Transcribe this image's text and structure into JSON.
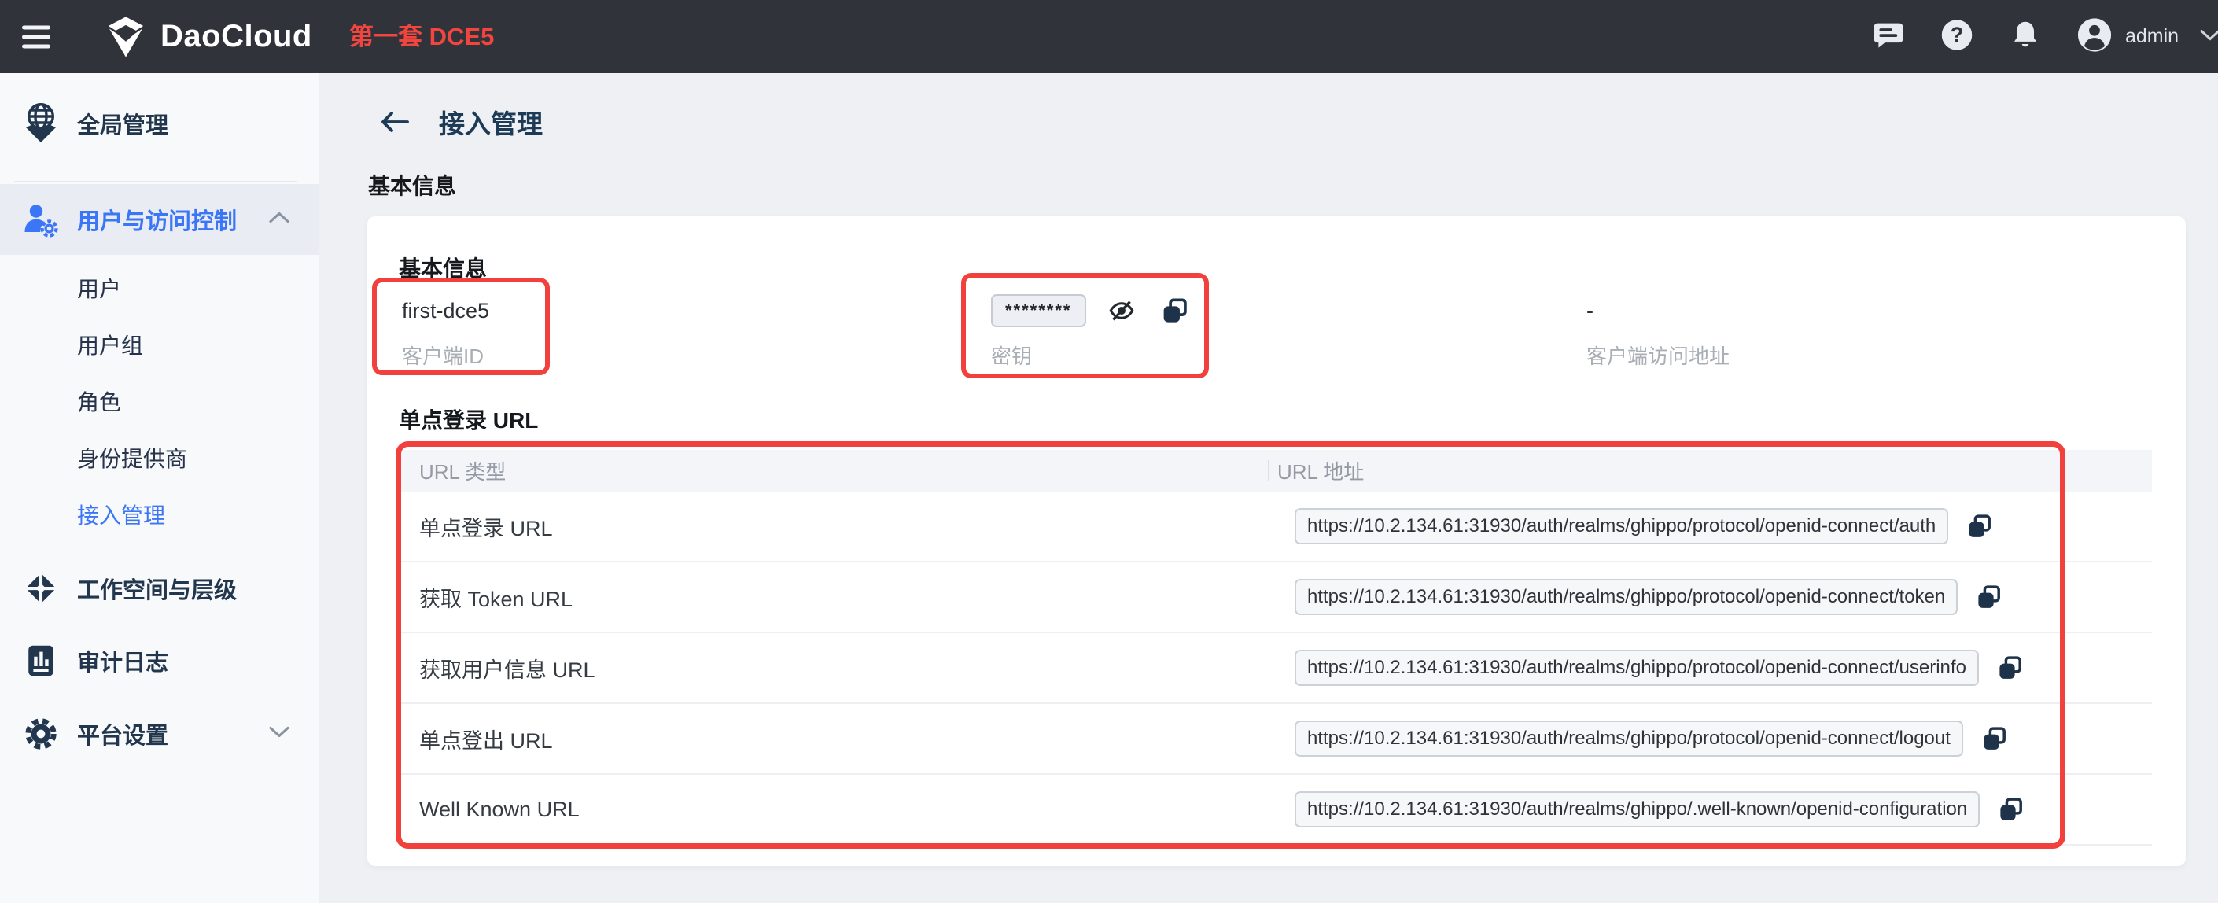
{
  "topbar": {
    "product_name": "DaoCloud",
    "env_title": "第一套 DCE5",
    "username": "admin"
  },
  "sidebar": {
    "global_item": "全局管理",
    "access_group": "用户与访问控制",
    "sub_items": [
      {
        "label": "用户"
      },
      {
        "label": "用户组"
      },
      {
        "label": "角色"
      },
      {
        "label": "身份提供商"
      },
      {
        "label": "接入管理"
      }
    ],
    "workspace_item": "工作空间与层级",
    "audit_item": "审计日志",
    "settings_item": "平台设置"
  },
  "page": {
    "title": "接入管理",
    "section_label": "基本信息"
  },
  "card": {
    "basic_heading": "基本信息",
    "client_id": {
      "value": "first-dce5",
      "label": "客户端ID"
    },
    "secret": {
      "masked_value": "********",
      "label": "密钥"
    },
    "client_access": {
      "value": "-",
      "label": "客户端访问地址"
    },
    "sso_heading": "单点登录 URL",
    "table": {
      "col_type": "URL 类型",
      "col_url": "URL 地址",
      "rows": [
        {
          "type": "单点登录 URL",
          "url": "https://10.2.134.61:31930/auth/realms/ghippo/protocol/openid-connect/auth"
        },
        {
          "type": "获取 Token URL",
          "url": "https://10.2.134.61:31930/auth/realms/ghippo/protocol/openid-connect/token"
        },
        {
          "type": "获取用户信息 URL",
          "url": "https://10.2.134.61:31930/auth/realms/ghippo/protocol/openid-connect/userinfo"
        },
        {
          "type": "单点登出 URL",
          "url": "https://10.2.134.61:31930/auth/realms/ghippo/protocol/openid-connect/logout"
        },
        {
          "type": "Well Known URL",
          "url": "https://10.2.134.61:31930/auth/realms/ghippo/.well-known/openid-configuration"
        }
      ]
    }
  },
  "colors": {
    "accent_red": "#f2413d",
    "accent_blue": "#3b76f6",
    "topbar_bg": "#30333a",
    "navy_text": "#22364e"
  }
}
